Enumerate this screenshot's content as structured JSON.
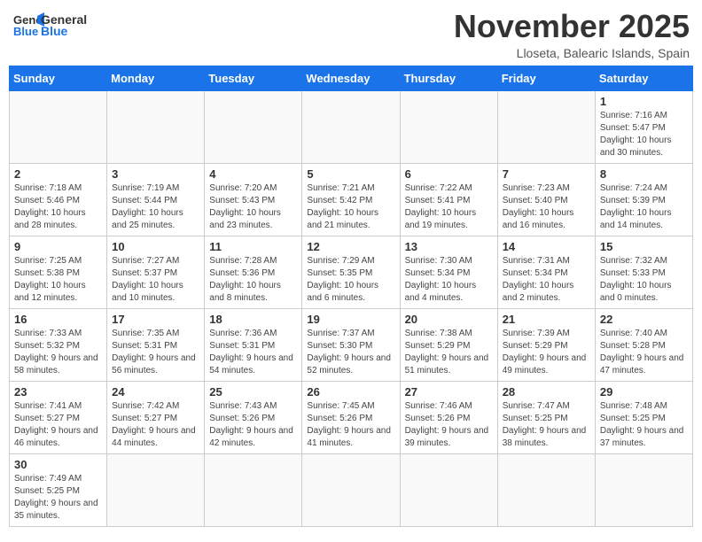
{
  "header": {
    "logo_general": "General",
    "logo_blue": "Blue",
    "month_title": "November 2025",
    "location": "Lloseta, Balearic Islands, Spain"
  },
  "weekdays": [
    "Sunday",
    "Monday",
    "Tuesday",
    "Wednesday",
    "Thursday",
    "Friday",
    "Saturday"
  ],
  "weeks": [
    [
      {
        "day": "",
        "info": ""
      },
      {
        "day": "",
        "info": ""
      },
      {
        "day": "",
        "info": ""
      },
      {
        "day": "",
        "info": ""
      },
      {
        "day": "",
        "info": ""
      },
      {
        "day": "",
        "info": ""
      },
      {
        "day": "1",
        "info": "Sunrise: 7:16 AM\nSunset: 5:47 PM\nDaylight: 10 hours and 30 minutes."
      }
    ],
    [
      {
        "day": "2",
        "info": "Sunrise: 7:18 AM\nSunset: 5:46 PM\nDaylight: 10 hours and 28 minutes."
      },
      {
        "day": "3",
        "info": "Sunrise: 7:19 AM\nSunset: 5:44 PM\nDaylight: 10 hours and 25 minutes."
      },
      {
        "day": "4",
        "info": "Sunrise: 7:20 AM\nSunset: 5:43 PM\nDaylight: 10 hours and 23 minutes."
      },
      {
        "day": "5",
        "info": "Sunrise: 7:21 AM\nSunset: 5:42 PM\nDaylight: 10 hours and 21 minutes."
      },
      {
        "day": "6",
        "info": "Sunrise: 7:22 AM\nSunset: 5:41 PM\nDaylight: 10 hours and 19 minutes."
      },
      {
        "day": "7",
        "info": "Sunrise: 7:23 AM\nSunset: 5:40 PM\nDaylight: 10 hours and 16 minutes."
      },
      {
        "day": "8",
        "info": "Sunrise: 7:24 AM\nSunset: 5:39 PM\nDaylight: 10 hours and 14 minutes."
      }
    ],
    [
      {
        "day": "9",
        "info": "Sunrise: 7:25 AM\nSunset: 5:38 PM\nDaylight: 10 hours and 12 minutes."
      },
      {
        "day": "10",
        "info": "Sunrise: 7:27 AM\nSunset: 5:37 PM\nDaylight: 10 hours and 10 minutes."
      },
      {
        "day": "11",
        "info": "Sunrise: 7:28 AM\nSunset: 5:36 PM\nDaylight: 10 hours and 8 minutes."
      },
      {
        "day": "12",
        "info": "Sunrise: 7:29 AM\nSunset: 5:35 PM\nDaylight: 10 hours and 6 minutes."
      },
      {
        "day": "13",
        "info": "Sunrise: 7:30 AM\nSunset: 5:34 PM\nDaylight: 10 hours and 4 minutes."
      },
      {
        "day": "14",
        "info": "Sunrise: 7:31 AM\nSunset: 5:34 PM\nDaylight: 10 hours and 2 minutes."
      },
      {
        "day": "15",
        "info": "Sunrise: 7:32 AM\nSunset: 5:33 PM\nDaylight: 10 hours and 0 minutes."
      }
    ],
    [
      {
        "day": "16",
        "info": "Sunrise: 7:33 AM\nSunset: 5:32 PM\nDaylight: 9 hours and 58 minutes."
      },
      {
        "day": "17",
        "info": "Sunrise: 7:35 AM\nSunset: 5:31 PM\nDaylight: 9 hours and 56 minutes."
      },
      {
        "day": "18",
        "info": "Sunrise: 7:36 AM\nSunset: 5:31 PM\nDaylight: 9 hours and 54 minutes."
      },
      {
        "day": "19",
        "info": "Sunrise: 7:37 AM\nSunset: 5:30 PM\nDaylight: 9 hours and 52 minutes."
      },
      {
        "day": "20",
        "info": "Sunrise: 7:38 AM\nSunset: 5:29 PM\nDaylight: 9 hours and 51 minutes."
      },
      {
        "day": "21",
        "info": "Sunrise: 7:39 AM\nSunset: 5:29 PM\nDaylight: 9 hours and 49 minutes."
      },
      {
        "day": "22",
        "info": "Sunrise: 7:40 AM\nSunset: 5:28 PM\nDaylight: 9 hours and 47 minutes."
      }
    ],
    [
      {
        "day": "23",
        "info": "Sunrise: 7:41 AM\nSunset: 5:27 PM\nDaylight: 9 hours and 46 minutes."
      },
      {
        "day": "24",
        "info": "Sunrise: 7:42 AM\nSunset: 5:27 PM\nDaylight: 9 hours and 44 minutes."
      },
      {
        "day": "25",
        "info": "Sunrise: 7:43 AM\nSunset: 5:26 PM\nDaylight: 9 hours and 42 minutes."
      },
      {
        "day": "26",
        "info": "Sunrise: 7:45 AM\nSunset: 5:26 PM\nDaylight: 9 hours and 41 minutes."
      },
      {
        "day": "27",
        "info": "Sunrise: 7:46 AM\nSunset: 5:26 PM\nDaylight: 9 hours and 39 minutes."
      },
      {
        "day": "28",
        "info": "Sunrise: 7:47 AM\nSunset: 5:25 PM\nDaylight: 9 hours and 38 minutes."
      },
      {
        "day": "29",
        "info": "Sunrise: 7:48 AM\nSunset: 5:25 PM\nDaylight: 9 hours and 37 minutes."
      }
    ],
    [
      {
        "day": "30",
        "info": "Sunrise: 7:49 AM\nSunset: 5:25 PM\nDaylight: 9 hours and 35 minutes."
      },
      {
        "day": "",
        "info": ""
      },
      {
        "day": "",
        "info": ""
      },
      {
        "day": "",
        "info": ""
      },
      {
        "day": "",
        "info": ""
      },
      {
        "day": "",
        "info": ""
      },
      {
        "day": "",
        "info": ""
      }
    ]
  ]
}
